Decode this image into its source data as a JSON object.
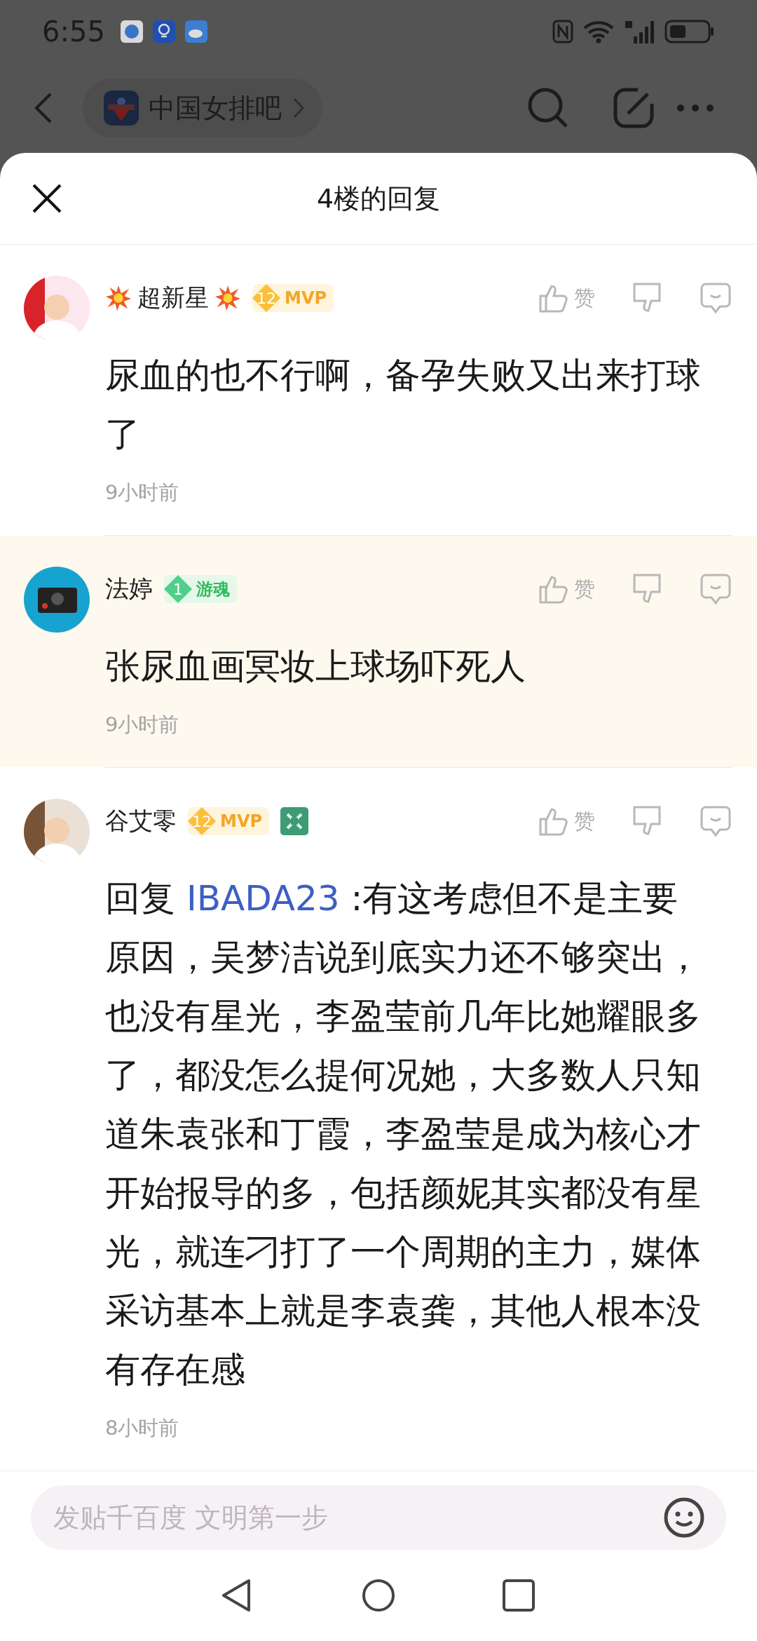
{
  "status_bar": {
    "time": "6:55"
  },
  "forum_bar": {
    "name": "中国女排吧"
  },
  "sheet": {
    "title": "4楼的回复"
  },
  "comments": [
    {
      "name": "超新星",
      "burst_decoration": true,
      "badge": {
        "kind": "mvp",
        "level": "12",
        "label": "MVP"
      },
      "medal": false,
      "highlighted": false,
      "like_label": "赞",
      "text": "尿血的也不行啊，备孕失败又出来打球了",
      "time": "9小时前"
    },
    {
      "name": "法婷",
      "burst_decoration": false,
      "badge": {
        "kind": "game",
        "level": "1",
        "label": "游魂"
      },
      "medal": false,
      "highlighted": true,
      "like_label": "赞",
      "text": "张尿血画冥妆上球场吓死人",
      "time": "9小时前"
    },
    {
      "name": "谷艾零",
      "burst_decoration": false,
      "badge": {
        "kind": "mvp",
        "level": "12",
        "label": "MVP"
      },
      "medal": true,
      "highlighted": false,
      "like_label": "赞",
      "reply_prefix": "回复",
      "reply_to": "IBADA23",
      "text": " :有这考虑但不是主要原因，吴梦洁说到底实力还不够突出，也没有星光，李盈莹前几年比她耀眼多了，都没怎么提何况她，大多数人只知道朱袁张和丁霞，李盈莹是成为核心才开始报导的多，包括颜妮其实都没有星光，就连刁打了一个周期的主力，媒体采访基本上就是李袁龚，其他人根本没有存在感",
      "time": "8小时前"
    }
  ],
  "composer": {
    "placeholder": "发贴千百度 文明第一步"
  }
}
